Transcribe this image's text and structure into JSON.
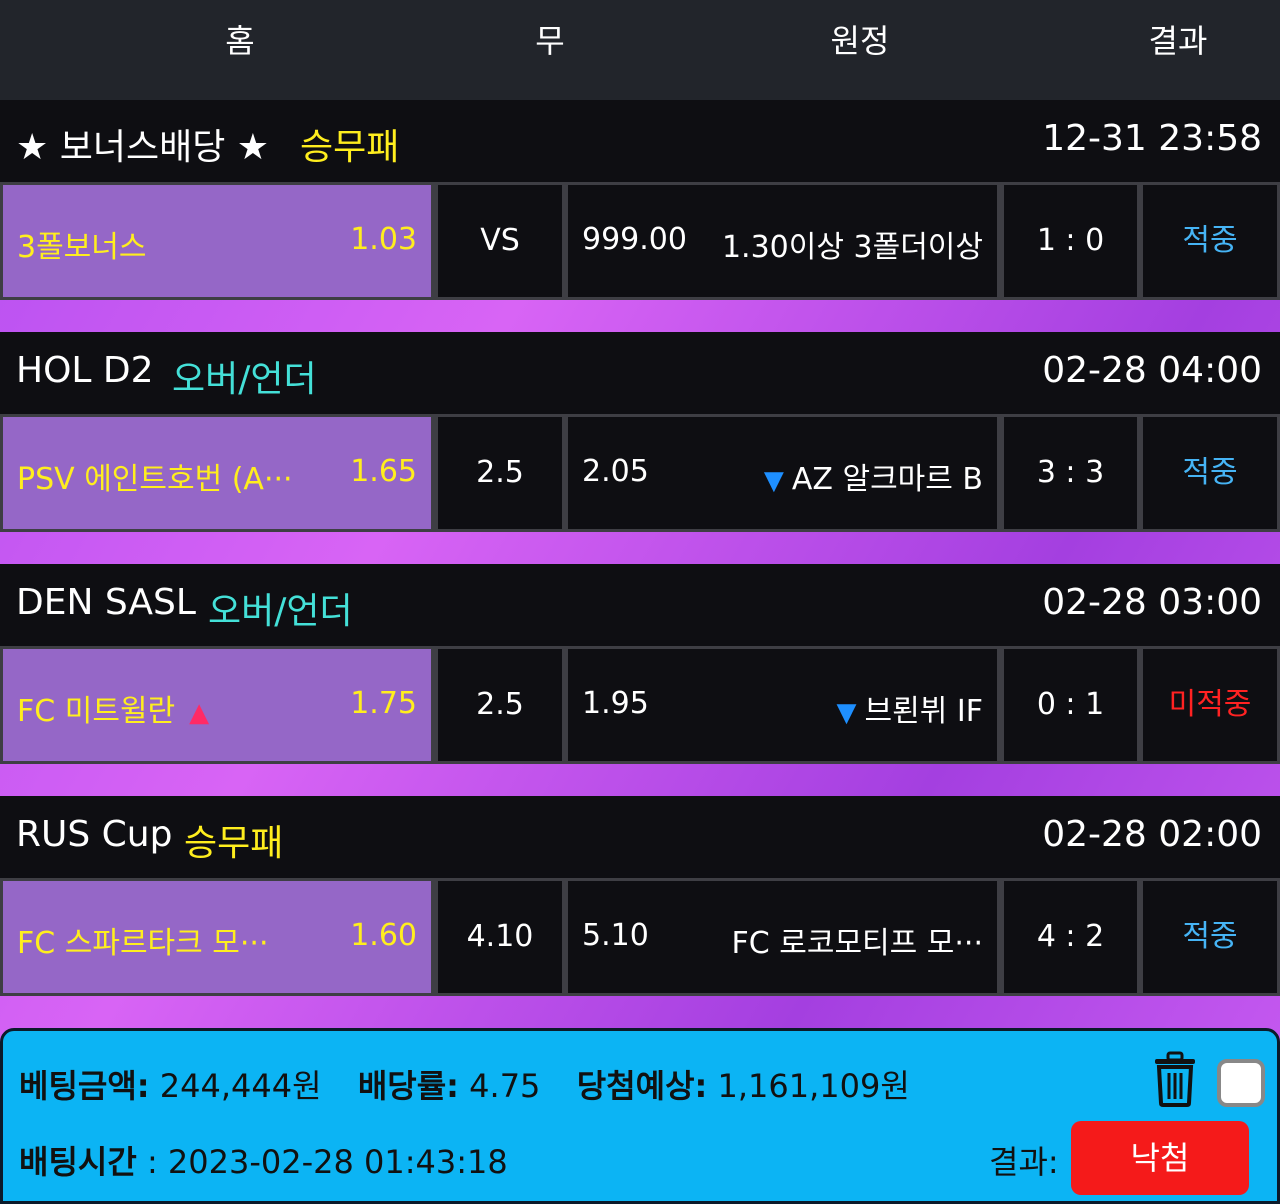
{
  "header": {
    "home": "홈",
    "draw": "무",
    "away": "원정",
    "result": "결과"
  },
  "groups": [
    {
      "league": "★ 보너스배당 ★",
      "market": "승무패",
      "market_color": "#ffee1e",
      "time": "12-31 23:58",
      "home_name": "3폴보너스",
      "home_odds": "1.03",
      "home_marker": "",
      "draw": "VS",
      "away_odds": "999.00",
      "away_marker": "",
      "away_name": "1.30이상 3폴더이상",
      "score": "1 : 0",
      "result": "적중",
      "result_color": "#46b4f5"
    },
    {
      "league": "HOL D2",
      "market": "오버/언더",
      "market_color": "#44e0d8",
      "time": "02-28 04:00",
      "home_name": "PSV 에인트호번 (A···",
      "home_odds": "1.65",
      "home_marker": "",
      "draw": "2.5",
      "away_odds": "2.05",
      "away_marker": "▼",
      "away_name": "AZ 알크마르 B",
      "score": "3 : 3",
      "result": "적중",
      "result_color": "#46b4f5"
    },
    {
      "league": "DEN SASL",
      "market": "오버/언더",
      "market_color": "#44e0d8",
      "time": "02-28 03:00",
      "home_name": "FC 미트윌란",
      "home_odds": "1.75",
      "home_marker": "▲",
      "draw": "2.5",
      "away_odds": "1.95",
      "away_marker": "▼",
      "away_name": "브뢴뷔 IF",
      "score": "0 : 1",
      "result": "미적중",
      "result_color": "#ff2222"
    },
    {
      "league": "RUS Cup",
      "market": "승무패",
      "market_color": "#ffee1e",
      "time": "02-28 02:00",
      "home_name": "FC 스파르타크 모···",
      "home_odds": "1.60",
      "home_marker": "",
      "draw": "4.10",
      "away_odds": "5.10",
      "away_marker": "",
      "away_name": "FC 로코모티프 모···",
      "score": "4 : 2",
      "result": "적중",
      "result_color": "#46b4f5"
    }
  ],
  "footer": {
    "bet_amount_label": "베팅금액:",
    "bet_amount": "244,444원",
    "odds_label": "배당률:",
    "odds": "4.75",
    "expected_label": "당첨예상:",
    "expected": "1,161,109원",
    "bet_time_label": "배팅시간",
    "bet_time": ": 2023-02-28 01:43:18",
    "result_label": "결과:",
    "result_button": "낙첨",
    "trash_icon": "trash-icon",
    "checkbox_checked": false
  }
}
